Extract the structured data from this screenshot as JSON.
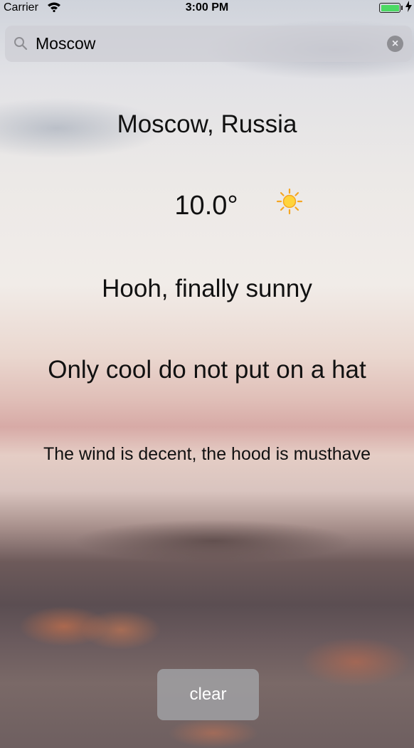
{
  "status_bar": {
    "carrier": "Carrier",
    "time": "3:00 PM",
    "battery_level": 1.0,
    "battery_color": "#4cd964"
  },
  "search": {
    "value": "Moscow",
    "icon": "search-icon",
    "clear_icon": "clear-text-icon"
  },
  "weather": {
    "city": "Moscow, Russia",
    "temperature": "10.0°",
    "condition_icon": "sun-icon",
    "condition_text": "Hooh, finally sunny",
    "advice": "Only cool do not put on a hat",
    "wind": "The wind is decent, the hood is musthave"
  },
  "buttons": {
    "clear_label": "clear"
  }
}
